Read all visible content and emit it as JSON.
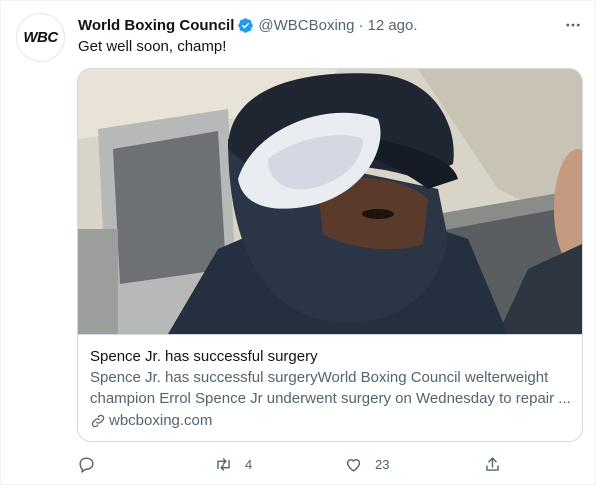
{
  "account": {
    "avatar_text": "WBC",
    "name": "World Boxing Council",
    "handle": "@WBCBoxing",
    "separator": "·",
    "time": "12 ago."
  },
  "tweet": {
    "text": "Get well soon, champ!"
  },
  "card": {
    "title": "Spence Jr. has successful surgery",
    "desc_line1": "Spence Jr. has successful surgeryWorld Boxing Council welterweight",
    "desc_line2": "champion Errol Spence Jr underwent surgery on Wednesday to repair ...",
    "domain": "wbcboxing.com"
  },
  "actions": {
    "retweets": "4",
    "likes": "23"
  },
  "colors": {
    "verified": "#1d9bf0",
    "secondary_text": "#536471",
    "border": "#cfd9de"
  },
  "icons": {
    "more": "more-icon",
    "verified": "verified-badge-icon",
    "link": "link-icon",
    "reply": "reply-icon",
    "retweet": "retweet-icon",
    "like": "like-icon",
    "share": "share-icon"
  }
}
